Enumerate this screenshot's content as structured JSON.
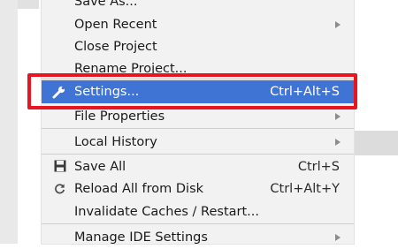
{
  "menu": {
    "items": [
      {
        "label": "Save As..."
      },
      {
        "label": "Open Recent"
      },
      {
        "label": "Close Project"
      },
      {
        "label": "Rename Project..."
      },
      {
        "label": "Settings...",
        "shortcut": "Ctrl+Alt+S",
        "icon": "wrench-icon"
      },
      {
        "label": "File Properties"
      },
      {
        "label": "Local History"
      },
      {
        "label": "Save All",
        "shortcut": "Ctrl+S",
        "icon": "floppy-disk-icon"
      },
      {
        "label": "Reload All from Disk",
        "shortcut": "Ctrl+Alt+Y",
        "icon": "reload-icon"
      },
      {
        "label": "Invalidate Caches / Restart..."
      },
      {
        "label": "Manage IDE Settings"
      }
    ]
  },
  "colors": {
    "selection": "#3f74d4",
    "annotation_box": "#e8141f",
    "menu_background": "#f2f2f2"
  }
}
